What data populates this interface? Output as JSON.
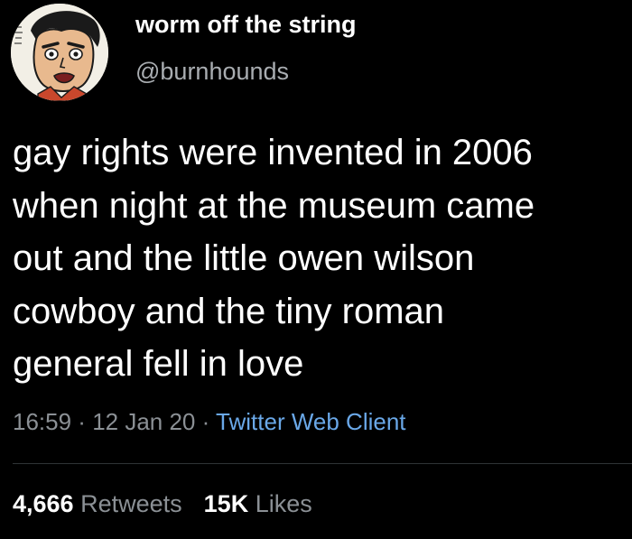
{
  "user": {
    "display_name": "worm off the string",
    "handle": "@burnhounds",
    "avatar_icon": "cartoon-face-avatar"
  },
  "tweet": {
    "lines": [
      "gay rights were invented in 2006",
      "when night at the museum came",
      "out and the little owen wilson",
      "cowboy and the tiny roman",
      "general fell in love"
    ]
  },
  "meta": {
    "time": "16:59",
    "separator": " · ",
    "date": "12 Jan 20",
    "client": "Twitter Web Client"
  },
  "stats": {
    "retweets_count": "4,666",
    "retweets_label": "Retweets",
    "likes_count": "15K",
    "likes_label": "Likes"
  },
  "colors": {
    "background": "#000000",
    "text_primary": "#ffffff",
    "text_secondary": "#8b9095",
    "link": "#6aa8e8"
  }
}
